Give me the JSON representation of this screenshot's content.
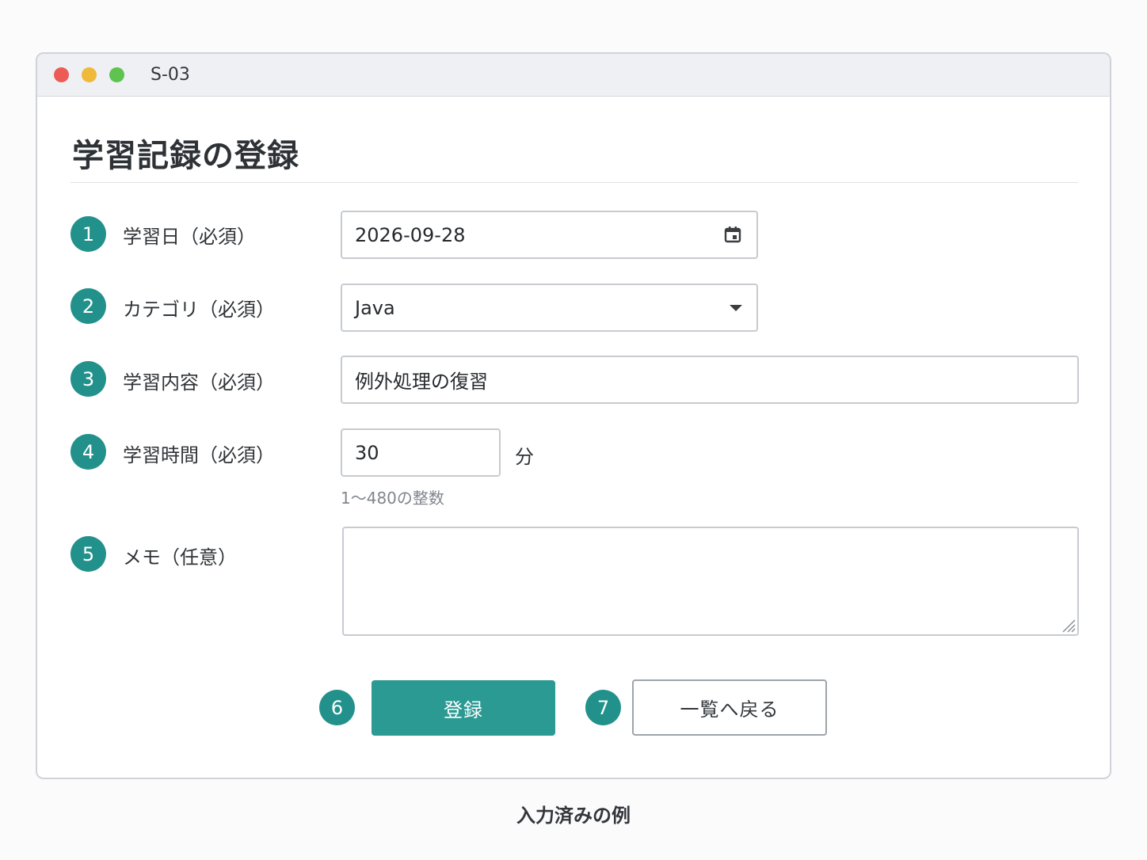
{
  "window": {
    "title": "S-03"
  },
  "form": {
    "title": "学習記録の登録",
    "fields": [
      {
        "step": "1",
        "label": "学習日（必須）",
        "value": "2026-09-28",
        "icon": "calendar-icon"
      },
      {
        "step": "2",
        "label": "カテゴリ（必須）",
        "value": "Java",
        "icon": "chevron-down-icon"
      },
      {
        "step": "3",
        "label": "学習内容（必須）",
        "value": "例外処理の復習"
      },
      {
        "step": "4",
        "label": "学習時間（必須）",
        "value": "30",
        "unit": "分",
        "hint": "1〜480の整数"
      },
      {
        "step": "5",
        "label": "メモ（任意）",
        "value": ""
      }
    ]
  },
  "actions": {
    "submit": {
      "step": "6",
      "label": "登録"
    },
    "back": {
      "step": "7",
      "label": "一覧へ戻る"
    }
  },
  "caption": "入力済みの例",
  "colors": {
    "accent": "#23918b",
    "button": "#2b9a93"
  }
}
